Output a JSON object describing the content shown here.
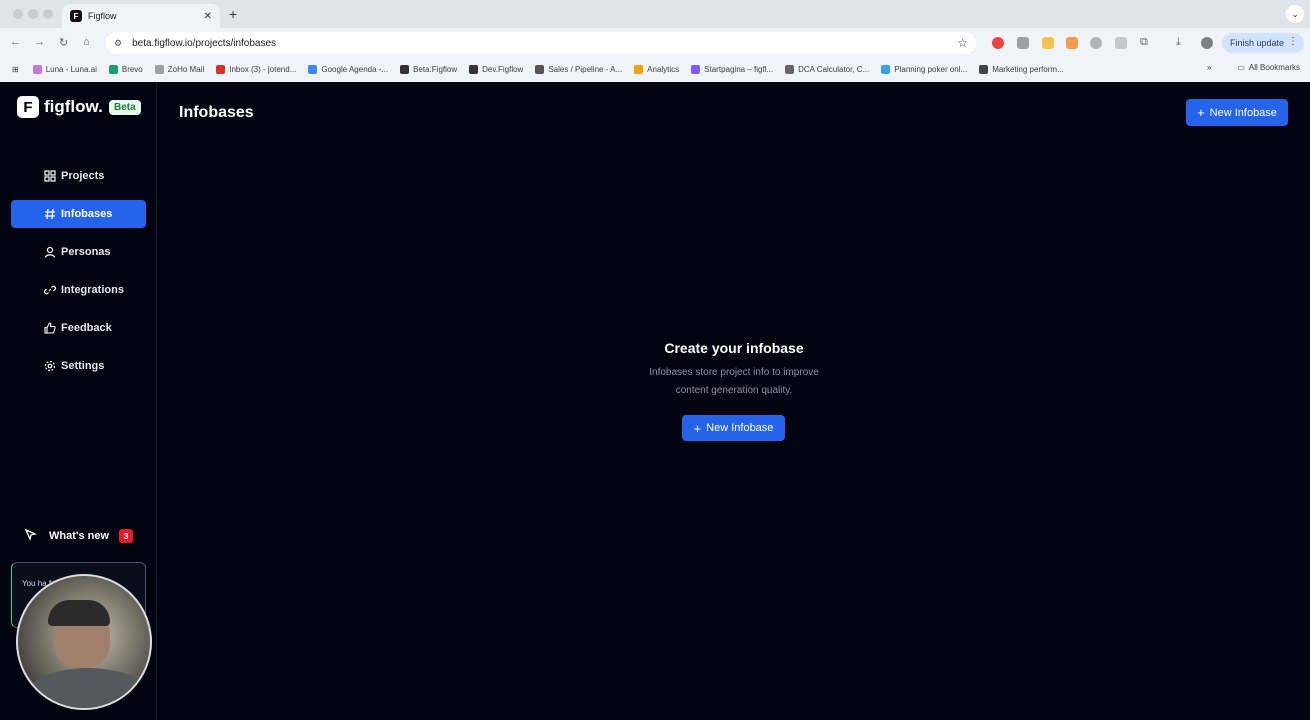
{
  "browser": {
    "tab_title": "Figflow",
    "tab_favicon": "F",
    "url": "beta.figflow.io/projects/infobases",
    "finish_update": "Finish update",
    "bookmarks": [
      {
        "label": "Luna - Luna.ai",
        "color": "#c07ad8"
      },
      {
        "label": "Brevo",
        "color": "#1a9e6a"
      },
      {
        "label": "ZoHo Mail",
        "color": "#9aa0a6"
      },
      {
        "label": "Inbox (3) - jotend...",
        "color": "#d93025"
      },
      {
        "label": "Google Agenda -...",
        "color": "#4285f4"
      },
      {
        "label": "Beta.Figflow",
        "color": "#333333"
      },
      {
        "label": "Dev.Figflow",
        "color": "#333333"
      },
      {
        "label": "Sales / Pipeline - A...",
        "color": "#555555"
      },
      {
        "label": "Analytics",
        "color": "#f4a400"
      },
      {
        "label": "Startpagina – figfl...",
        "color": "#7c5cff"
      },
      {
        "label": "DCA Calculator, C...",
        "color": "#666666"
      },
      {
        "label": "Planning poker onl...",
        "color": "#3aa3e3"
      },
      {
        "label": "Marketing perform...",
        "color": "#444444"
      }
    ],
    "all_bookmarks": "All Bookmarks"
  },
  "app": {
    "logo_text": "figflow.",
    "logo_mark": "F",
    "beta_badge": "Beta",
    "nav": [
      {
        "label": "Projects",
        "icon": "grid-icon"
      },
      {
        "label": "Infobases",
        "icon": "hash-icon"
      },
      {
        "label": "Personas",
        "icon": "user-icon"
      },
      {
        "label": "Integrations",
        "icon": "link-icon"
      },
      {
        "label": "Feedback",
        "icon": "thumbs-up-icon"
      },
      {
        "label": "Settings",
        "icon": "gear-icon"
      }
    ],
    "active_nav": "Infobases",
    "whats_new": "What's new",
    "whats_new_count": "3",
    "trial_text": "You ha                    free",
    "page_title": "Infobases",
    "new_infobase_button": "New Infobase",
    "empty_state": {
      "title": "Create your infobase",
      "description": "Infobases store project info to improve content generation quality.",
      "button": "New Infobase"
    },
    "accent_color": "#2563eb"
  }
}
